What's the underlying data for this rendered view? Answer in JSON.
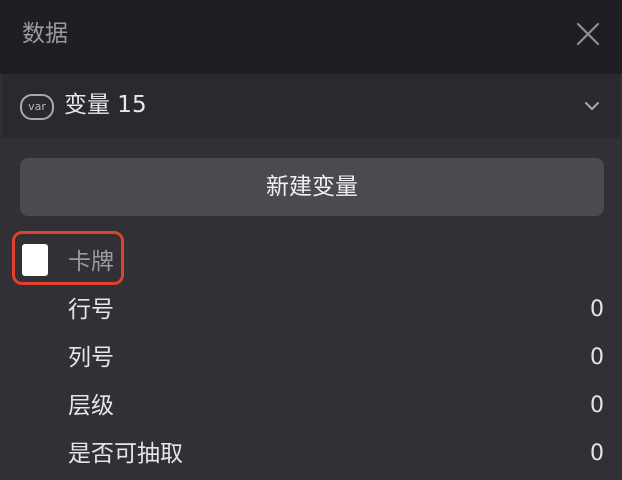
{
  "panel": {
    "title": "数据",
    "close_icon": "close-icon"
  },
  "variable": {
    "badge": "var",
    "title": "变量 15",
    "expand_icon": "chevron-down-icon"
  },
  "actions": {
    "new_variable": "新建变量"
  },
  "card": {
    "label": "卡牌",
    "checked": false
  },
  "properties": [
    {
      "label": "行号",
      "value": "0"
    },
    {
      "label": "列号",
      "value": "0"
    },
    {
      "label": "层级",
      "value": "0"
    },
    {
      "label": "是否可抽取",
      "value": "0"
    }
  ],
  "colors": {
    "highlight": "#e0412c",
    "titlebar_bg": "#1f1f23",
    "panel_bg": "#303035",
    "button_bg": "#4a4a50"
  }
}
